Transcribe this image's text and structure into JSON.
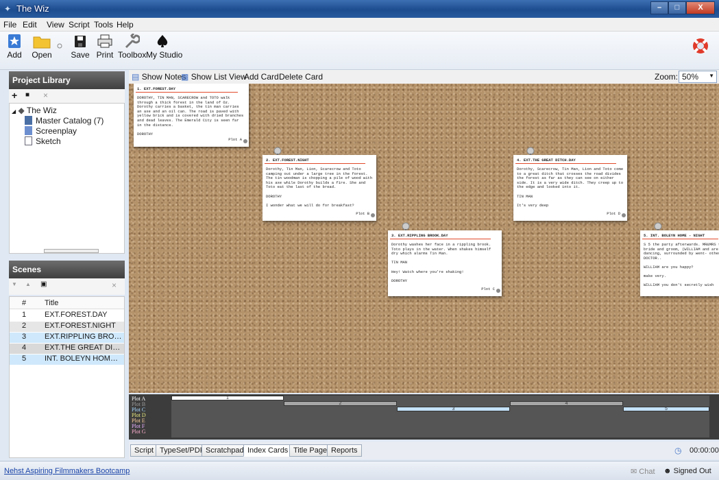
{
  "window": {
    "title": "The Wiz"
  },
  "menu": [
    "File",
    "Edit",
    "View",
    "Script",
    "Tools",
    "Help"
  ],
  "toolbar": {
    "add": "Add",
    "open": "Open",
    "save": "Save",
    "print": "Print",
    "toolbox": "Toolbox",
    "mystudio": "My Studio"
  },
  "library": {
    "header": "Project Library",
    "root": "The Wiz",
    "items": [
      "Master Catalog (7)",
      "Screenplay",
      "Sketch"
    ]
  },
  "scenes": {
    "header": "Scenes",
    "col_num": "#",
    "col_title": "Title",
    "rows": [
      {
        "num": "1",
        "title": "EXT.FOREST.DAY"
      },
      {
        "num": "2",
        "title": "EXT.FOREST.NIGHT"
      },
      {
        "num": "3",
        "title": "EXT.RIPPLING BROOK...."
      },
      {
        "num": "4",
        "title": "EXT.THE GREAT DITC..."
      },
      {
        "num": "5",
        "title": "INT. BOLEYN HOME - ..."
      }
    ]
  },
  "cardbar": {
    "show_notes": "Show Notes",
    "show_list": "Show List View",
    "add_card": "Add Card",
    "delete_card": "Delete Card",
    "zoom_label": "Zoom:",
    "zoom_value": "50%"
  },
  "cards": [
    {
      "title": "1. EXT.FOREST.DAY",
      "text": "DOROTHY, TIN MAN, SCARECROW and TOTO walk through a thick forest in the land of Oz. Dorothy carries a basket, the tin man carries an axe and an oil can. The road is paved with yellow brick and is covered with dried branches and dead leaves. The Emerald City is seen far in the distance.\n\nDOROTHY",
      "plot": "Plot A"
    },
    {
      "title": "2. EXT.FOREST.NIGHT",
      "text": "Dorothy, Tin Man, Lion, Scarecrow and Toto camping out under a large tree in the forest. The tin woodman is chopping a pile of wood with his axe while Dorothy builds a fire. She and Toto eat the last of the bread.\n\nDOROTHY\n\nI wonder what we will do for breakfast?",
      "plot": "Plot B"
    },
    {
      "title": "3. EXT.RIPPLING BROOK.DAY",
      "text": "Dorothy washes her face in a rippling brook. Toto plays in the water. When shakes himself dry which alarms Tin Man.\n\nTIN MAN\n\nHey! Watch where you're shaking!\n\nDOROTHY",
      "plot": "Plot C"
    },
    {
      "title": "4. EXT.THE GREAT DITCH.DAY",
      "text": "Dorothy, Scarecrow, Tin Man, Lion and Toto come to a great ditch that crosses the road divides the forest as far as they can see on either side. It is a very wide ditch. They creep up to the edge and looked into it.\n\nTIN MAN\n\nIt's very deep",
      "plot": "Plot D"
    },
    {
      "title": "5. INT. BOLEYN HOME - NIGHT",
      "text": "S 5 the party afterwards. MR&MRS the bride and groom, (WILLIAM and are dancing, surrounded by went- other DOCTOR..\n\nWILLIAM are you happy?\n\nmake very.\n\nWILLIAM you don't secretly wish",
      "plot": ""
    }
  ],
  "plots": [
    "Plot A",
    "Plot B",
    "Plot C",
    "Plot D",
    "Plot E",
    "Plot F",
    "Plot G"
  ],
  "plot_colors": [
    "#ffffff",
    "#9a9a9a",
    "#a8d8ff",
    "#e8e880",
    "#ffd0a0",
    "#e8b0ff",
    "#ffb0d0"
  ],
  "timeline_segments": [
    "1",
    "2",
    "3",
    "4",
    "5"
  ],
  "tabs": [
    "Script",
    "TypeSet/PDF",
    "Scratchpad",
    "Index Cards",
    "Title Page",
    "Reports"
  ],
  "active_tab": "Index Cards",
  "status": {
    "link": "Nehst Aspiring Filmmakers Bootcamp",
    "timer": "00:00:00",
    "chat": "Chat",
    "signed": "Signed Out"
  }
}
